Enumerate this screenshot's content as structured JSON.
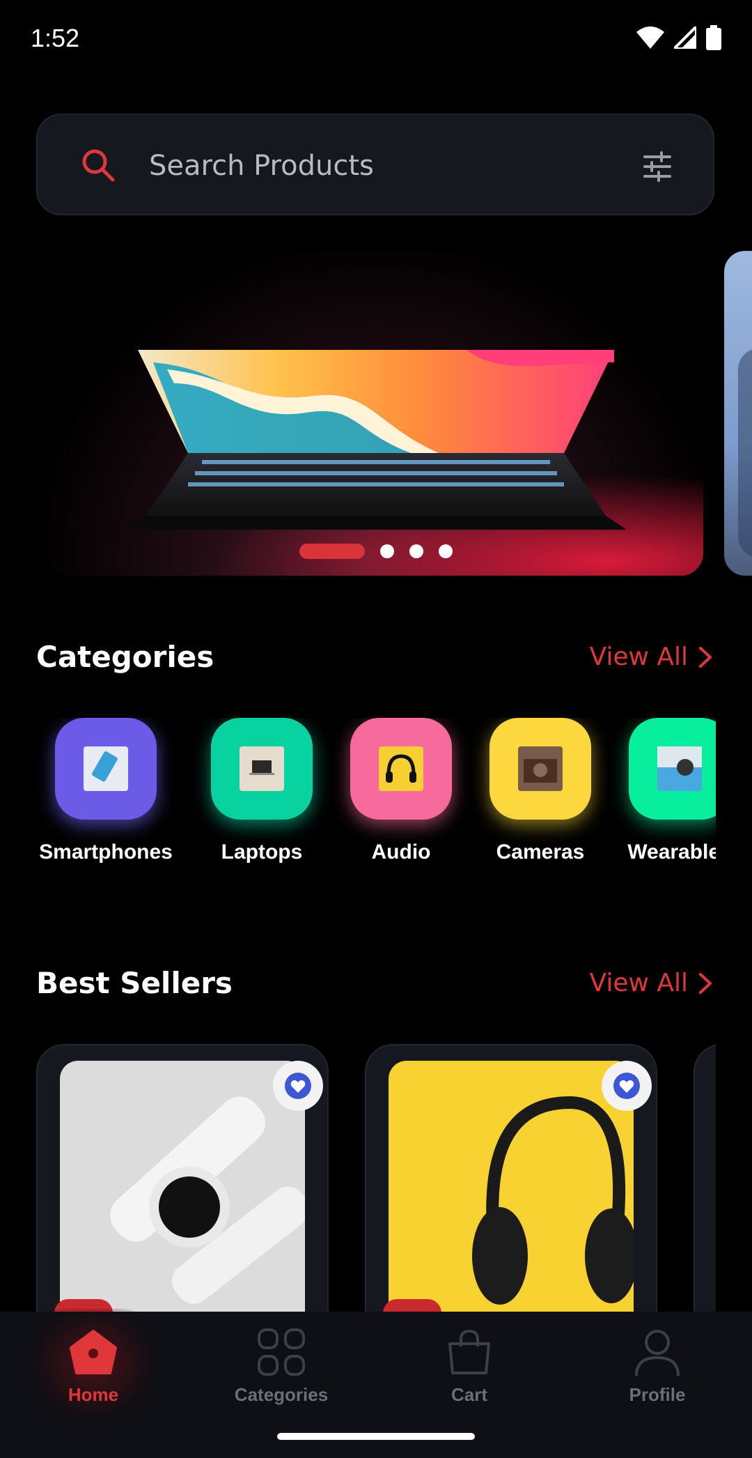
{
  "status_bar": {
    "time": "1:52"
  },
  "search": {
    "placeholder": "Search Products",
    "search_icon": "search-icon",
    "filter_icon": "sliders-icon"
  },
  "banner": {
    "slides": 4,
    "active_slide": 1
  },
  "categories_section": {
    "title": "Categories",
    "view_all": "View All",
    "items": [
      {
        "label": "Smartphones",
        "color": "#6b5be6"
      },
      {
        "label": "Laptops",
        "color": "#08d3a0"
      },
      {
        "label": "Audio",
        "color": "#f76a9c"
      },
      {
        "label": "Cameras",
        "color": "#fcd83e"
      },
      {
        "label": "Wearables",
        "color": "#07ee9e"
      }
    ]
  },
  "best_sellers_section": {
    "title": "Best Sellers",
    "view_all": "View All",
    "products": [
      {
        "name": "watch",
        "favorite": true
      },
      {
        "name": "headphones",
        "favorite": true
      }
    ]
  },
  "bottom_nav": {
    "items": [
      {
        "label": "Home",
        "icon": "home-icon",
        "active": true
      },
      {
        "label": "Categories",
        "icon": "grid-icon",
        "active": false
      },
      {
        "label": "Cart",
        "icon": "bag-icon",
        "active": false
      },
      {
        "label": "Profile",
        "icon": "person-icon",
        "active": false
      }
    ]
  },
  "colors": {
    "accent": "#e0373a",
    "surface": "#15181f",
    "background": "#000000",
    "nav_inactive": "#6b6f78"
  }
}
